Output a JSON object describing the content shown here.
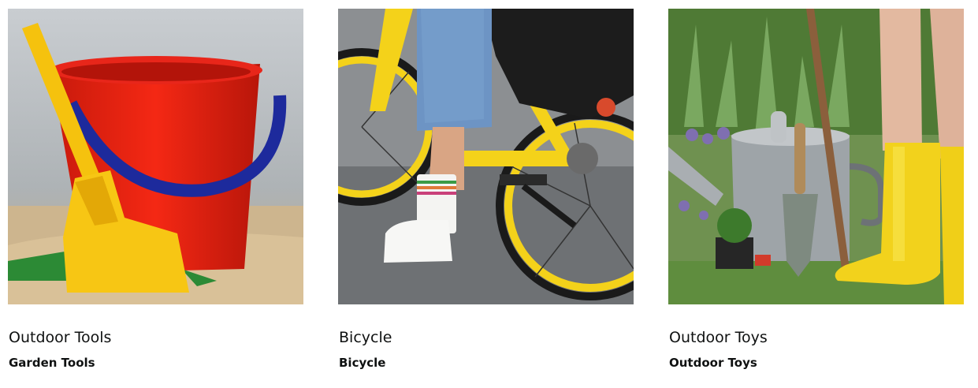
{
  "cards": [
    {
      "title": "Outdoor Tools",
      "subtitle": "Garden Tools",
      "image": "beach-bucket-and-spade-image"
    },
    {
      "title": "Bicycle",
      "subtitle": "Bicycle",
      "image": "yellow-bicycle-image"
    },
    {
      "title": "Outdoor Toys",
      "subtitle": "Outdoor Toys",
      "image": "watering-can-and-boots-image"
    }
  ]
}
